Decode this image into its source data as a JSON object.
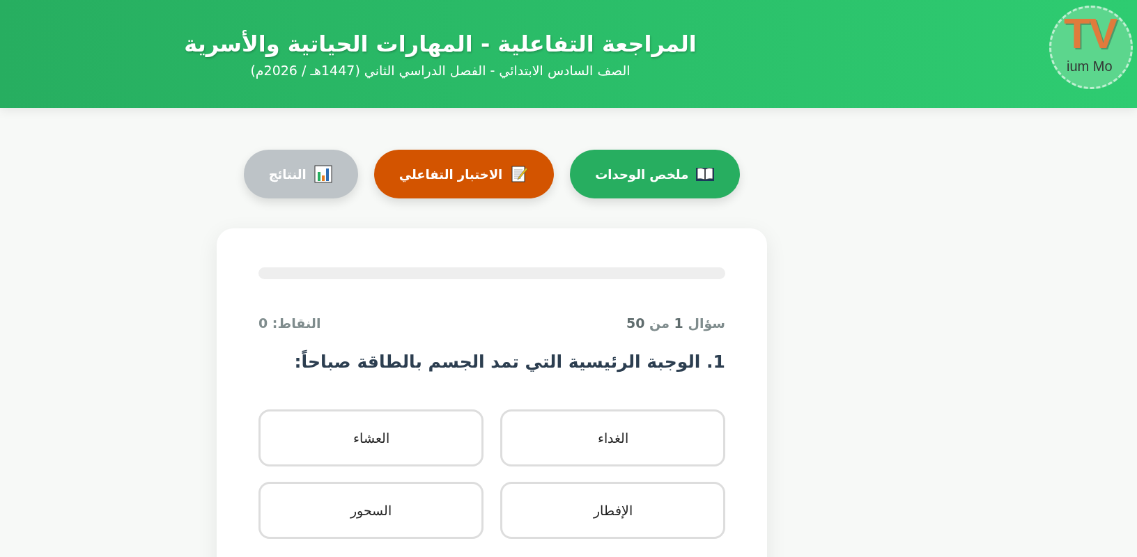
{
  "header": {
    "title": "المراجعة التفاعلية - المهارات الحياتية والأسرية",
    "subtitle": "الصف السادس الابتدائي - الفصل الدراسي الثاني (1447هـ / 2026م)",
    "logo": {
      "mark": "TV",
      "caption": "ium Mo"
    }
  },
  "tabs": [
    {
      "label": "ملخص الوحدات",
      "kind": "book",
      "color": "#27ae60"
    },
    {
      "label": "الاختبار التفاعلي",
      "kind": "memo",
      "color": "#d35400"
    },
    {
      "label": "النتائج",
      "kind": "chart",
      "color": "#bdc3c7"
    }
  ],
  "quiz": {
    "progress": {
      "level": 0
    },
    "counter": "سؤال **1** من **50**",
    "score": "النقاط: 0",
    "question": "1. الوجبة الرئيسية التي تمد الجسم بالطاقة صباحاً:",
    "options": [
      {
        "label": "الغداء",
        "selected": false
      },
      {
        "label": "العشاء",
        "selected": false
      },
      {
        "label": "الإفطار",
        "selected": false
      },
      {
        "label": "السحور",
        "selected": false
      }
    ]
  }
}
